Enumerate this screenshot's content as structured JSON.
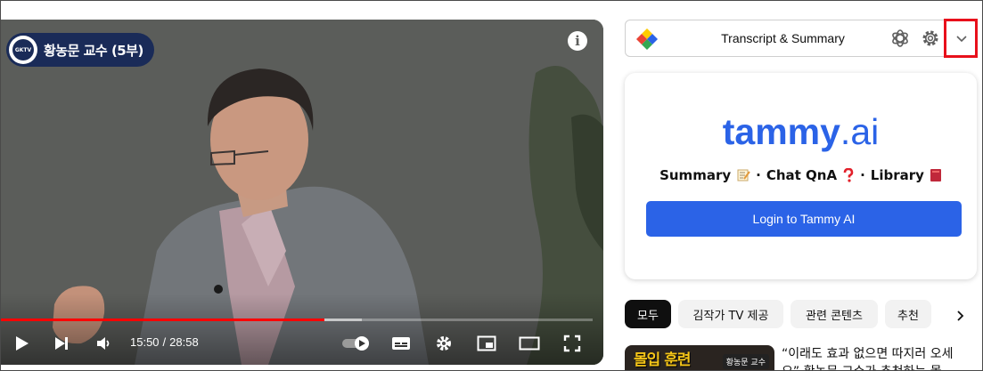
{
  "player": {
    "channel_badge": "황농문 교수 (5부)",
    "badge_logo_text": "GKTV",
    "info_icon": "info-icon",
    "time_current": "15:50",
    "time_separator": "/",
    "time_total": "28:58",
    "progress_played_fraction": 0.546,
    "progress_buffered_fraction": 0.61,
    "progress_color": "#ff0000",
    "controls": {
      "play": "play-icon",
      "next": "skip-next-icon",
      "volume": "volume-icon",
      "autoplay": "autoplay-toggle-icon",
      "subtitles": "subtitles-icon",
      "settings": "settings-gear-icon",
      "miniplayer": "miniplayer-icon",
      "theater": "theater-mode-icon",
      "fullscreen": "fullscreen-icon"
    }
  },
  "extension": {
    "title": "Transcript & Summary",
    "icons": [
      "extension-logo-icon",
      "openai-icon",
      "gear-icon",
      "chevron-down-icon"
    ],
    "highlight_color": "#e8101b"
  },
  "tammy": {
    "logo_bold": "tammy",
    "logo_light": ".ai",
    "brand_color": "#2b63e7",
    "features": [
      {
        "label": "Summary",
        "icon": "memo-icon"
      },
      {
        "label": "Chat QnA",
        "icon": "question-mark-icon"
      },
      {
        "label": "Library",
        "icon": "book-icon"
      }
    ],
    "feature_separator": "·",
    "login_label": "Login to Tammy AI"
  },
  "chips": {
    "items": [
      {
        "label": "모두",
        "active": true
      },
      {
        "label": "김작가 TV 제공",
        "active": false
      },
      {
        "label": "관련 콘텐츠",
        "active": false
      },
      {
        "label": "추천",
        "active": false
      }
    ],
    "next_icon": "chevron-right-icon"
  },
  "recommended": {
    "thumb_text": "몰입 훈련",
    "thumb_tag": "황농문 교수",
    "title": "“이래도 효과 없으면 따지러 오세요” 황농문 교수가 추천하는 몰"
  }
}
